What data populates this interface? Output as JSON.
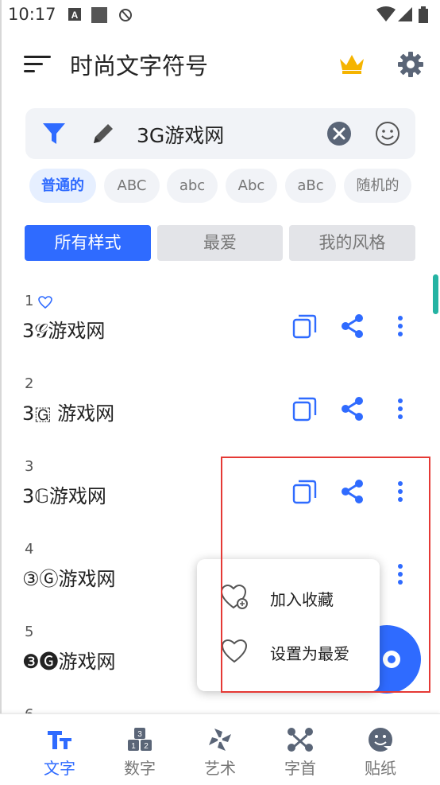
{
  "status_bar": {
    "time": "10:17"
  },
  "app_bar": {
    "title": "时尚文字符号",
    "crown_icon": "crown-icon",
    "settings_icon": "gear-icon"
  },
  "search": {
    "value": "3G游戏网"
  },
  "chips": [
    "普通的",
    "ABC",
    "abc",
    "Abc",
    "aBc",
    "随机的"
  ],
  "tabs": [
    "所有样式",
    "最爱",
    "我的风格"
  ],
  "rows": [
    {
      "num": "1",
      "text": "3𝒢游戏网"
    },
    {
      "num": "2",
      "text": "3🇬 游戏网"
    },
    {
      "num": "3",
      "text": "3𝔾游戏网"
    },
    {
      "num": "4",
      "text": "③Ⓖ游戏网"
    },
    {
      "num": "5",
      "text": "❸🅖游戏网"
    },
    {
      "num": "6",
      "text": ""
    }
  ],
  "context_menu": {
    "add_favorite": "加入收藏",
    "set_favorite": "设置为最爱"
  },
  "bottom_nav": [
    {
      "label": "文字",
      "icon": "text-format-icon"
    },
    {
      "label": "数字",
      "icon": "number-blocks-icon"
    },
    {
      "label": "艺术",
      "icon": "pinwheel-icon"
    },
    {
      "label": "字首",
      "icon": "bone-icon"
    },
    {
      "label": "贴纸",
      "icon": "smiley-sticker-icon"
    }
  ],
  "colors": {
    "accent": "#2f6bff",
    "highlight_box": "#e53935",
    "scroll_thumb": "#25b3a3"
  }
}
